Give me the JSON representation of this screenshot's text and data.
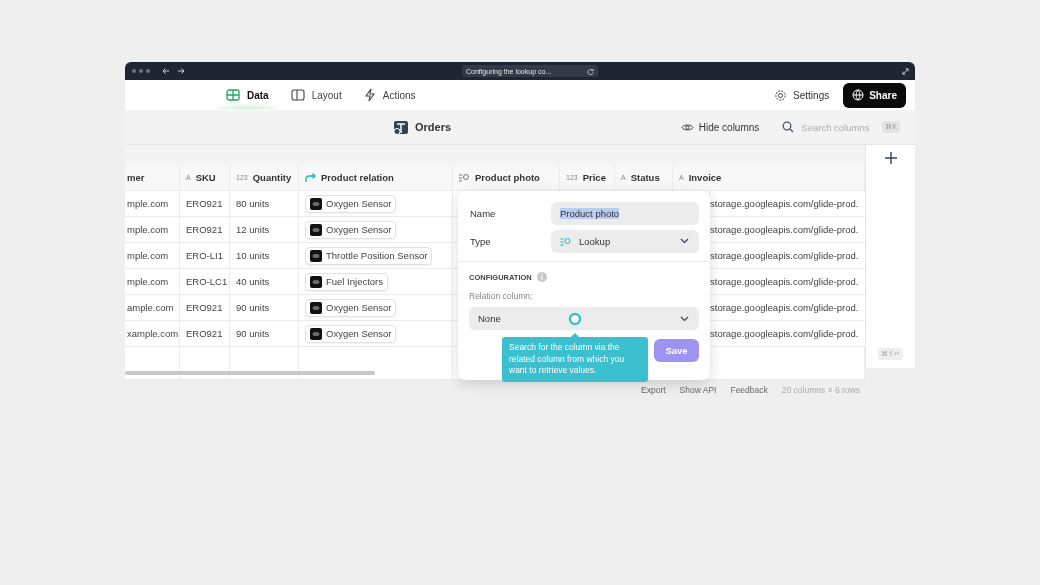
{
  "browser": {
    "url": "Configuring the lookup co..."
  },
  "nav": {
    "tabs": [
      {
        "label": "Data",
        "kind": "data",
        "selected": true
      },
      {
        "label": "Layout",
        "kind": "layout",
        "selected": false
      },
      {
        "label": "Actions",
        "kind": "actions",
        "selected": false
      }
    ],
    "settings": "Settings",
    "share": "Share"
  },
  "toolbar": {
    "title": "Orders",
    "hide_columns": "Hide columns",
    "search": {
      "placeholder": "Search columns"
    },
    "shortcut": "⌘K"
  },
  "table": {
    "columns": [
      {
        "label": "mer",
        "kind": "plain"
      },
      {
        "label": "SKU",
        "kind": "text",
        "type_mark": "A"
      },
      {
        "label": "Quantity",
        "kind": "number",
        "type_mark": "123"
      },
      {
        "label": "Product relation",
        "kind": "relation"
      },
      {
        "label": "Product photo",
        "kind": "lookup"
      },
      {
        "label": "Price",
        "kind": "number",
        "type_mark": "123"
      },
      {
        "label": "Status",
        "kind": "text",
        "type_mark": "A"
      },
      {
        "label": "Invoice",
        "kind": "text",
        "type_mark": "A"
      }
    ],
    "rows": [
      {
        "customer": "mple.com",
        "sku": "ERO921",
        "quantity": "80 units",
        "relation": "Oxygen Sensor",
        "invoice": "storage.googleapis.com/glide-prod."
      },
      {
        "customer": "mple.com",
        "sku": "ERO921",
        "quantity": "12 units",
        "relation": "Oxygen Sensor",
        "invoice": "storage.googleapis.com/glide-prod."
      },
      {
        "customer": "mple.com",
        "sku": "ERO-LI1",
        "quantity": "10 units",
        "relation": "Throttle Position Sensor",
        "invoice": "storage.googleapis.com/glide-prod."
      },
      {
        "customer": "mple.com",
        "sku": "ERO-LC1",
        "quantity": "40 units",
        "relation": "Fuel Injectors",
        "invoice": "storage.googleapis.com/glide-prod."
      },
      {
        "customer": "ample.com",
        "sku": "ERO921",
        "quantity": "90 units",
        "relation": "Oxygen Sensor",
        "invoice": "storage.googleapis.com/glide-prod."
      },
      {
        "customer": "xample.com",
        "sku": "ERO921",
        "quantity": "90 units",
        "relation": "Oxygen Sensor",
        "invoice": "storage.googleapis.com/glide-prod."
      }
    ],
    "add_shortcut": "⌘⇧↵"
  },
  "popover": {
    "name_label": "Name",
    "name_value": "Product photo",
    "type_label": "Type",
    "type_value": "Lookup",
    "section": "CONFIGURATION",
    "relation_label": "Relation column:",
    "relation_value": "None",
    "save": "Save",
    "save_disabled": true
  },
  "tooltip": "Search for the column via the related column from which you want to retrieve values.",
  "footer": {
    "links": [
      "Export",
      "Show API",
      "Feedback"
    ],
    "summary": "20 columns × 6 rows"
  }
}
